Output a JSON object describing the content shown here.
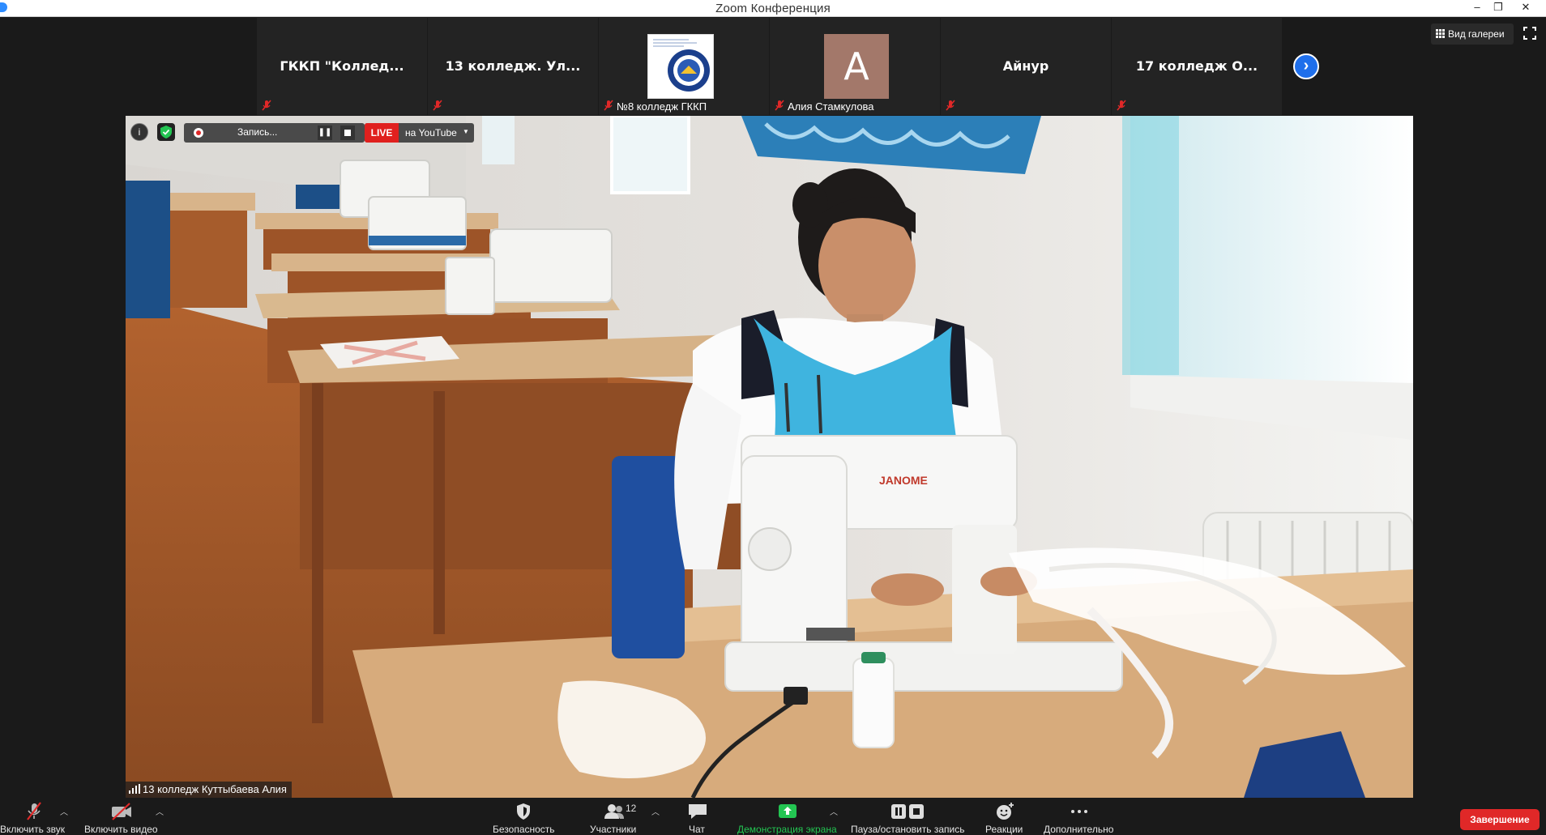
{
  "window": {
    "title": "Zoom Конференция",
    "minimize": "–",
    "restore": "❐",
    "close": "✕"
  },
  "gallery_strip": {
    "tiles": [
      {
        "name": "ГККП  \"Коллед...",
        "muted": true
      },
      {
        "name": "13  колледж. Ул...",
        "muted": true
      },
      {
        "name": "№8 колледж ГККП",
        "muted": true,
        "has_image": true
      },
      {
        "name": "Алия Стамкулова",
        "muted": true,
        "avatar_letter": "A"
      },
      {
        "name": "Айнур",
        "muted": true
      },
      {
        "name": "17  колледж   О...",
        "muted": true
      }
    ],
    "next_icon": "chevron-right"
  },
  "view_controls": {
    "gallery_view_label": "Вид галереи",
    "fullscreen_icon": "fullscreen"
  },
  "recording_bar": {
    "info": "i",
    "recording_label": "Запись...",
    "live_badge": "LIVE",
    "stream_target": "на YouTube"
  },
  "active_speaker": {
    "label": "13 колледж Куттыбаева Алия"
  },
  "toolbar": {
    "unmute": "Включить звук",
    "start_video": "Включить видео",
    "security": "Безопасность",
    "participants": "Участники",
    "participants_count": "12",
    "chat": "Чат",
    "share_screen": "Демонстрация экрана",
    "pause_stop_recording": "Пауза/остановить запись",
    "reactions": "Реакции",
    "more": "Дополнительно",
    "end": "Завершение"
  },
  "colors": {
    "background": "#1a1a1a",
    "tile": "#232323",
    "accent_blue": "#1f6feb",
    "mute_red": "#e02828",
    "share_green": "#23c552",
    "end_red": "#e02828"
  }
}
